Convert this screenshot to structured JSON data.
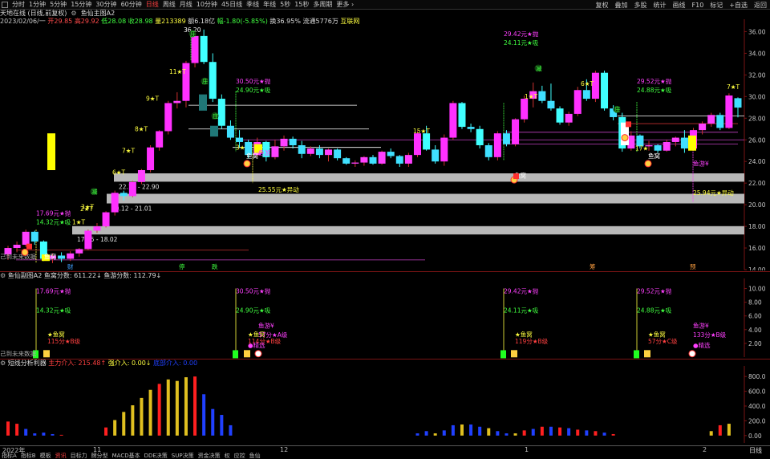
{
  "toolbar": {
    "left": [
      "分时",
      "1分钟",
      "5分钟",
      "15分钟",
      "30分钟",
      "60分钟",
      "日线",
      "周线",
      "月线",
      "10分钟",
      "45日线",
      "季线",
      "年线",
      "5秒",
      "15秒",
      "多周期",
      "更多 ›"
    ],
    "active": "日线",
    "right": [
      "复权",
      "叠加",
      "多股",
      "统计",
      "画线",
      "F10",
      "标记",
      "+自选",
      "返回"
    ]
  },
  "main_header": {
    "title": "天地在线 (日线,前复权)",
    "formula": "鱼仙主图A2",
    "date": "2023/02/06/一",
    "open": "开29.85",
    "high": "高29.92",
    "low": "低28.08",
    "close": "收28.98",
    "volume": "量213389",
    "amount": "额6.18亿",
    "change": "幅-1.80(-5.85%)",
    "turnover": "换36.95%",
    "float_cap": "流通5776万",
    "sector": "互联网"
  },
  "main_axis": {
    "min": 14,
    "max": 37,
    "ticks": [
      36,
      34,
      32,
      30,
      28,
      26,
      24,
      22,
      20,
      18,
      16,
      14
    ],
    "tick_labels": [
      "36.00",
      "34.00",
      "32.00",
      "30.00",
      "28.00",
      "26.00",
      "24.00",
      "22.00",
      "20.00",
      "18.00",
      "16.00",
      "14.00"
    ]
  },
  "main_annotations": {
    "high_mark": "36.20",
    "zones": [
      "22.13 - 22.90",
      "20.12 - 21.01",
      "17.25 - 18.02"
    ],
    "labels_a": [
      {
        "top": "17.69元★抛",
        "bot": "14.32元★吸"
      },
      {
        "top": "30.50元★抛",
        "bot": "24.90元★吸"
      },
      {
        "top": "29.42元★抛",
        "bot": "24.11元★吸"
      },
      {
        "top": "29.52元★抛",
        "bot": "24.88元★吸"
      }
    ],
    "t_marks": [
      "1★T",
      "2★T",
      "3★T",
      "6★T",
      "7★T",
      "8★T",
      "9★T",
      "11★T",
      "1★T",
      "6★T",
      "7★T",
      "15★T",
      "3★",
      "17★"
    ],
    "green_marks": [
      "减",
      "减",
      "庄",
      "庄",
      "庄",
      "跌",
      "筹"
    ],
    "yuwo": "鱼窝",
    "youwu": "鱼游",
    "yuyou_y": "鱼游¥",
    "yidong1": "25.55元★异动",
    "yidong2": "25.94元★异动",
    "futureline": "己到未来数据",
    "bottom_marks": [
      "财",
      "停",
      "跌",
      "筹",
      "预"
    ]
  },
  "sub1": {
    "title": "鱼仙副图A2",
    "score": "鱼窝分数: 611.22↓",
    "score2": "鱼游分数: 112.79↓",
    "axis": [
      "10.00",
      "8.00",
      "6.00",
      "4.00",
      "2.00"
    ],
    "grades": [
      "115分★B级",
      "114分★B级",
      "57分★A级",
      "119分★B级",
      "57分★C级",
      "133分★B级"
    ],
    "jingxuan": "●精选",
    "yuwo": "★鱼窝"
  },
  "sub2": {
    "title": "短线分析利器",
    "main_in": "主力介入: 215.48↑",
    "strong_in": "强介入: 0.00↓",
    "dark_in": "底部介入: 0.00",
    "axis": [
      "800.0",
      "600.0",
      "400.0",
      "200.0",
      "0.00"
    ]
  },
  "time_axis": {
    "labels": [
      "2022年",
      "11",
      "12",
      "1",
      "2"
    ],
    "period": "日线"
  },
  "bottom_tabs": {
    "items": [
      "指标A",
      "指标B",
      "模板",
      "资讯",
      "目标力",
      "牌分型",
      "MACD基本",
      "DDE决策",
      "SUP决策",
      "资金决策",
      "权",
      "应控",
      "鱼仙"
    ],
    "active": "资讯"
  },
  "chart_data": [
    {
      "type": "candlestick",
      "title": "天地在线 (日线,前复权)",
      "x_range": [
        "2022-10-24",
        "2023-02-06"
      ],
      "ylim": [
        14,
        37
      ],
      "ohlc_approx": [
        [
          15.4,
          16.2,
          14.9,
          16.0
        ],
        [
          16.0,
          16.6,
          15.6,
          16.3
        ],
        [
          16.3,
          17.7,
          16.1,
          17.5
        ],
        [
          17.5,
          17.6,
          16.3,
          16.6
        ],
        [
          16.6,
          16.7,
          14.8,
          15.0
        ],
        [
          15.0,
          15.5,
          14.6,
          15.3
        ],
        [
          15.3,
          15.6,
          14.7,
          15.0
        ],
        [
          15.0,
          15.7,
          14.8,
          15.5
        ],
        [
          15.5,
          16.0,
          15.2,
          15.9
        ],
        [
          15.9,
          17.7,
          15.8,
          17.6
        ],
        [
          17.6,
          18.3,
          17.4,
          18.0
        ],
        [
          18.0,
          19.4,
          17.9,
          19.3
        ],
        [
          19.3,
          21.3,
          19.0,
          21.1
        ],
        [
          21.1,
          21.3,
          20.4,
          20.8
        ],
        [
          20.8,
          22.2,
          20.7,
          22.1
        ],
        [
          22.1,
          23.3,
          21.9,
          23.2
        ],
        [
          23.2,
          25.5,
          23.0,
          25.3
        ],
        [
          25.3,
          26.9,
          25.0,
          26.8
        ],
        [
          26.8,
          29.6,
          26.5,
          29.4
        ],
        [
          29.4,
          30.4,
          28.9,
          29.6
        ],
        [
          29.6,
          33.3,
          29.0,
          33.1
        ],
        [
          33.1,
          35.9,
          32.7,
          35.6
        ],
        [
          35.6,
          36.2,
          33.0,
          33.2
        ],
        [
          33.2,
          34.0,
          29.5,
          29.8
        ],
        [
          29.8,
          30.2,
          27.0,
          27.3
        ],
        [
          27.3,
          27.8,
          26.0,
          26.2
        ],
        [
          26.2,
          26.9,
          25.3,
          25.8
        ],
        [
          25.8,
          26.0,
          24.3,
          24.6
        ],
        [
          24.6,
          26.2,
          24.4,
          25.8
        ],
        [
          25.8,
          25.9,
          24.0,
          24.4
        ],
        [
          24.4,
          26.0,
          24.2,
          25.4
        ],
        [
          25.4,
          26.4,
          25.0,
          26.1
        ],
        [
          26.1,
          26.3,
          25.2,
          25.5
        ],
        [
          25.5,
          25.9,
          24.3,
          24.7
        ],
        [
          24.7,
          25.4,
          24.5,
          25.2
        ],
        [
          25.2,
          25.5,
          24.3,
          24.6
        ],
        [
          24.6,
          25.2,
          24.0,
          25.1
        ],
        [
          25.1,
          25.2,
          24.1,
          24.3
        ],
        [
          24.3,
          24.4,
          23.7,
          23.8
        ],
        [
          23.8,
          24.1,
          23.5,
          23.9
        ],
        [
          23.9,
          24.5,
          23.6,
          24.4
        ],
        [
          24.4,
          24.6,
          23.7,
          23.8
        ],
        [
          23.8,
          25.0,
          23.7,
          24.9
        ],
        [
          24.9,
          25.2,
          24.3,
          24.5
        ],
        [
          24.5,
          24.6,
          23.5,
          23.8
        ],
        [
          23.8,
          24.8,
          23.5,
          24.6
        ],
        [
          24.6,
          26.8,
          24.4,
          26.6
        ],
        [
          26.6,
          27.3,
          25.0,
          25.1
        ],
        [
          25.1,
          25.5,
          23.8,
          24.0
        ],
        [
          24.0,
          26.5,
          23.6,
          26.2
        ],
        [
          26.2,
          29.6,
          26.0,
          29.4
        ],
        [
          29.4,
          29.5,
          27.0,
          27.2
        ],
        [
          27.2,
          27.5,
          26.7,
          27.0
        ],
        [
          27.0,
          27.3,
          25.2,
          25.5
        ],
        [
          25.5,
          25.7,
          24.1,
          24.4
        ],
        [
          24.4,
          26.8,
          24.1,
          26.6
        ],
        [
          26.6,
          26.9,
          25.4,
          25.6
        ],
        [
          25.6,
          28.0,
          25.4,
          27.9
        ],
        [
          27.9,
          30.1,
          27.6,
          29.8
        ],
        [
          29.8,
          31.3,
          29.0,
          30.5
        ],
        [
          30.5,
          31.0,
          29.4,
          29.6
        ],
        [
          29.6,
          31.2,
          28.7,
          28.9
        ],
        [
          28.9,
          29.1,
          27.4,
          27.6
        ],
        [
          27.6,
          28.6,
          27.3,
          28.4
        ],
        [
          28.4,
          30.9,
          28.2,
          30.6
        ],
        [
          30.6,
          31.6,
          29.6,
          29.8
        ],
        [
          29.8,
          32.4,
          29.5,
          32.2
        ],
        [
          32.2,
          32.4,
          28.7,
          28.9
        ],
        [
          28.9,
          29.2,
          27.8,
          28.1
        ],
        [
          28.1,
          28.5,
          24.9,
          25.2
        ],
        [
          25.2,
          26.8,
          25.0,
          26.4
        ],
        [
          26.4,
          26.5,
          25.2,
          25.4
        ],
        [
          25.4,
          25.9,
          25.0,
          25.5
        ],
        [
          25.5,
          25.6,
          24.8,
          25.0
        ],
        [
          25.0,
          26.0,
          24.9,
          25.8
        ],
        [
          25.8,
          26.3,
          25.4,
          26.2
        ],
        [
          26.2,
          26.9,
          24.8,
          25.2
        ],
        [
          25.2,
          27.1,
          25.0,
          26.9
        ],
        [
          26.9,
          27.7,
          26.5,
          27.5
        ],
        [
          27.5,
          28.5,
          27.2,
          28.3
        ],
        [
          28.3,
          28.5,
          26.9,
          27.1
        ],
        [
          27.1,
          30.3,
          27.0,
          30.1
        ],
        [
          29.85,
          29.92,
          28.08,
          28.98
        ]
      ]
    },
    {
      "type": "bar",
      "title": "短线分析利器",
      "ylim": [
        -100,
        900
      ],
      "series": [
        {
          "name": "主力介入",
          "values_approx": [
            190,
            160,
            90,
            30,
            40,
            20,
            10,
            0,
            0,
            0,
            0,
            110,
            210,
            320,
            410,
            510,
            620,
            700,
            760,
            740,
            790,
            800,
            560,
            360,
            280,
            140,
            0,
            0,
            0,
            0,
            0,
            0,
            0,
            0,
            0,
            0,
            0,
            0,
            0,
            0,
            0,
            0,
            0,
            0,
            0,
            0,
            30,
            60,
            30,
            70,
            140,
            150,
            150,
            120,
            100,
            60,
            30,
            30,
            70,
            90,
            120,
            120,
            110,
            100,
            80,
            70,
            60,
            40,
            20,
            0,
            0,
            0,
            0,
            0,
            0,
            0,
            0,
            0,
            0,
            60,
            140,
            160
          ]
        }
      ]
    }
  ]
}
